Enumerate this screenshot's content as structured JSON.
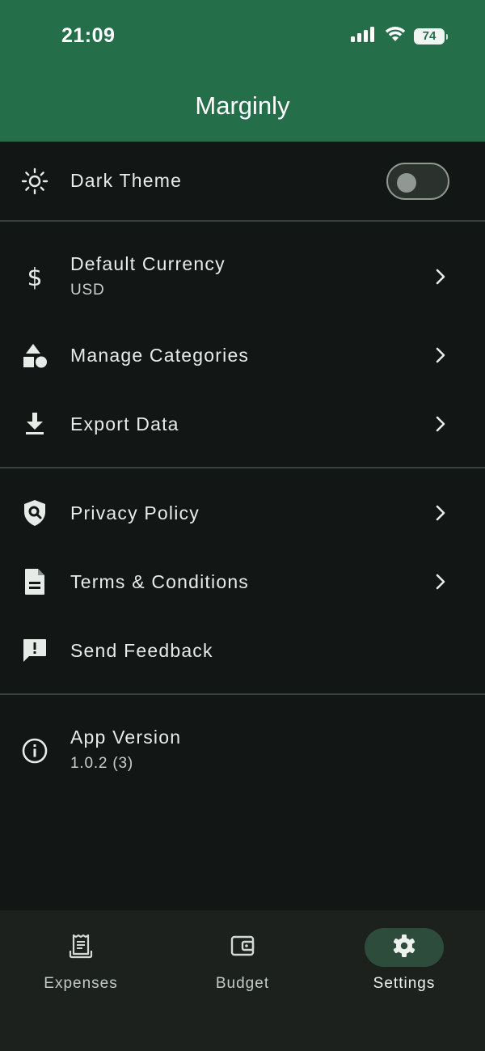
{
  "status_bar": {
    "time": "21:09",
    "battery": "74",
    "icons": [
      "cellular-signal-icon",
      "wifi-icon",
      "battery-icon"
    ]
  },
  "app_bar": {
    "title": "Marginly"
  },
  "settings": {
    "dark_theme": {
      "label": "Dark Theme",
      "icon": "sun-icon",
      "enabled": false
    },
    "default_currency": {
      "label": "Default Currency",
      "value": "USD",
      "icon": "dollar-icon"
    },
    "manage_categories": {
      "label": "Manage Categories",
      "icon": "shapes-icon"
    },
    "export_data": {
      "label": "Export Data",
      "icon": "download-icon"
    },
    "privacy_policy": {
      "label": "Privacy Policy",
      "icon": "shield-search-icon"
    },
    "terms_conditions": {
      "label": "Terms & Conditions",
      "icon": "document-icon"
    },
    "send_feedback": {
      "label": "Send Feedback",
      "icon": "feedback-icon"
    },
    "app_version": {
      "label": "App Version",
      "value": "1.0.2 (3)",
      "icon": "info-icon"
    }
  },
  "bottom_nav": {
    "items": [
      {
        "label": "Expenses",
        "icon": "receipt-icon",
        "active": false
      },
      {
        "label": "Budget",
        "icon": "wallet-icon",
        "active": false
      },
      {
        "label": "Settings",
        "icon": "gear-icon",
        "active": true
      }
    ]
  },
  "colors": {
    "header": "#256e4a",
    "background": "#121614",
    "nav_background": "#1c211e",
    "active_indicator": "#2e4c3c"
  }
}
